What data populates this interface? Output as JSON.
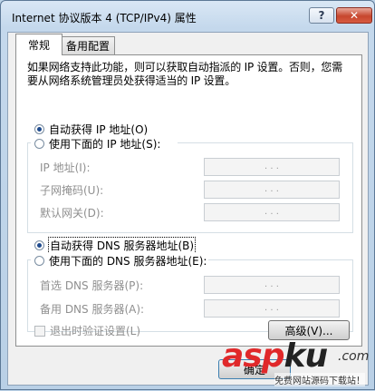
{
  "window": {
    "title": "Internet 协议版本 4 (TCP/IPv4) 属性",
    "help_label": "?",
    "close_label": "✕"
  },
  "tabs": [
    {
      "label": "常规",
      "active": true
    },
    {
      "label": "备用配置",
      "active": false
    }
  ],
  "description": "如果网络支持此功能，则可以获取自动指派的 IP 设置。否则，您需要从网络系统管理员处获得适当的 IP 设置。",
  "ip": {
    "auto_label": "自动获得 IP 地址(O)",
    "manual_label": "使用下面的 IP 地址(S):",
    "selected": "auto",
    "fields": [
      {
        "label": "IP 地址(I):",
        "value": ". . ."
      },
      {
        "label": "子网掩码(U):",
        "value": ". . ."
      },
      {
        "label": "默认网关(D):",
        "value": ". . ."
      }
    ]
  },
  "dns": {
    "auto_label": "自动获得 DNS 服务器地址(B)",
    "manual_label": "使用下面的 DNS 服务器地址(E):",
    "selected": "auto",
    "fields": [
      {
        "label": "首选 DNS 服务器(P):",
        "value": ". . ."
      },
      {
        "label": "备用 DNS 服务器(A):",
        "value": ". . ."
      }
    ]
  },
  "validate_label": "退出时验证设置(L)",
  "advanced_label": "高级(V)...",
  "ok_label": "确定",
  "watermark": {
    "logo_a": "asp",
    "logo_b": "ku",
    "suffix": ".com",
    "tagline": "免费网站源码下载站！"
  }
}
